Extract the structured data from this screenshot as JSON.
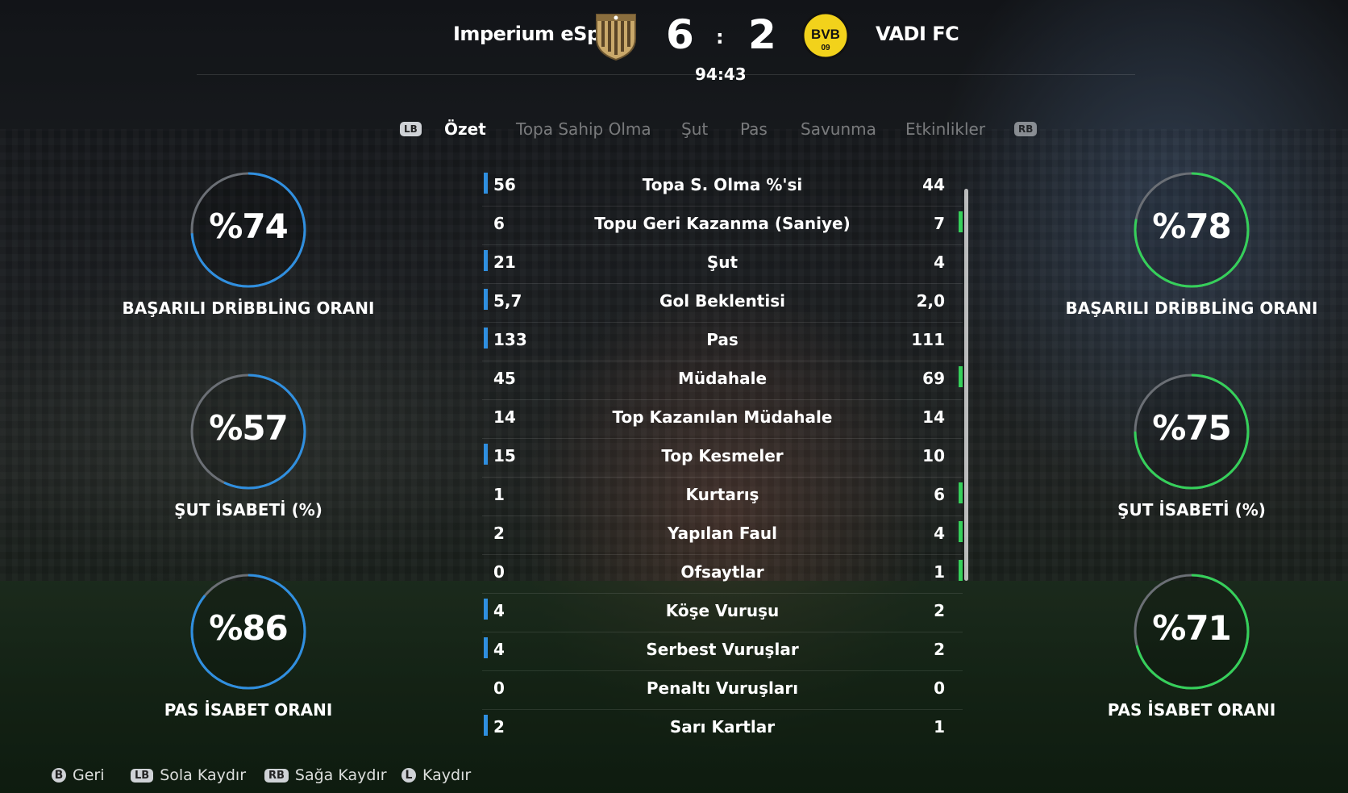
{
  "header": {
    "home_team": "Imperium eSp",
    "away_team": "VADI FC",
    "home_score": "6",
    "away_score": "2",
    "score_separator": ":",
    "clock": "94:43",
    "away_crest_text": "BVB",
    "away_crest_sub": "09"
  },
  "tabs": {
    "prev_button": "LB",
    "next_button": "RB",
    "items": [
      {
        "label": "Özet",
        "active": true
      },
      {
        "label": "Topa Sahip Olma",
        "active": false
      },
      {
        "label": "Şut",
        "active": false
      },
      {
        "label": "Pas",
        "active": false
      },
      {
        "label": "Savunma",
        "active": false
      },
      {
        "label": "Etkinlikler",
        "active": false
      }
    ]
  },
  "stats": [
    {
      "label": "Topa S. Olma %'si",
      "home": "56",
      "away": "44",
      "leader": "home"
    },
    {
      "label": "Topu Geri Kazanma (Saniye)",
      "home": "6",
      "away": "7",
      "leader": "away"
    },
    {
      "label": "Şut",
      "home": "21",
      "away": "4",
      "leader": "home"
    },
    {
      "label": "Gol Beklentisi",
      "home": "5,7",
      "away": "2,0",
      "leader": "home"
    },
    {
      "label": "Pas",
      "home": "133",
      "away": "111",
      "leader": "home"
    },
    {
      "label": "Müdahale",
      "home": "45",
      "away": "69",
      "leader": "away"
    },
    {
      "label": "Top Kazanılan Müdahale",
      "home": "14",
      "away": "14",
      "leader": "none"
    },
    {
      "label": "Top Kesmeler",
      "home": "15",
      "away": "10",
      "leader": "home"
    },
    {
      "label": "Kurtarış",
      "home": "1",
      "away": "6",
      "leader": "away"
    },
    {
      "label": "Yapılan Faul",
      "home": "2",
      "away": "4",
      "leader": "away"
    },
    {
      "label": "Ofsaytlar",
      "home": "0",
      "away": "1",
      "leader": "away"
    },
    {
      "label": "Köşe Vuruşu",
      "home": "4",
      "away": "2",
      "leader": "home"
    },
    {
      "label": "Serbest Vuruşlar",
      "home": "4",
      "away": "2",
      "leader": "home"
    },
    {
      "label": "Penaltı Vuruşları",
      "home": "0",
      "away": "0",
      "leader": "none"
    },
    {
      "label": "Sarı Kartlar",
      "home": "2",
      "away": "1",
      "leader": "home"
    }
  ],
  "gauges": {
    "home": [
      {
        "value": "%74",
        "percent": 74,
        "label": "BAŞARILI DRİBBLİNG ORANI"
      },
      {
        "value": "%57",
        "percent": 57,
        "label": "ŞUT İSABETİ (%)"
      },
      {
        "value": "%86",
        "percent": 86,
        "label": "PAS İSABET ORANI"
      }
    ],
    "away": [
      {
        "value": "%78",
        "percent": 78,
        "label": "BAŞARILI DRİBBLİNG ORANI"
      },
      {
        "value": "%75",
        "percent": 75,
        "label": "ŞUT İSABETİ (%)"
      },
      {
        "value": "%71",
        "percent": 71,
        "label": "PAS İSABET ORANI"
      }
    ]
  },
  "colors": {
    "home_accent": "#2f8fe0",
    "away_accent": "#35d05a",
    "gauge_track": "#6b6f75"
  },
  "footer": [
    {
      "button": "B",
      "label": "Geri"
    },
    {
      "button": "LB",
      "label": "Sola Kaydır"
    },
    {
      "button": "RB",
      "label": "Sağa Kaydır"
    },
    {
      "button": "L",
      "label": "Kaydır"
    }
  ]
}
